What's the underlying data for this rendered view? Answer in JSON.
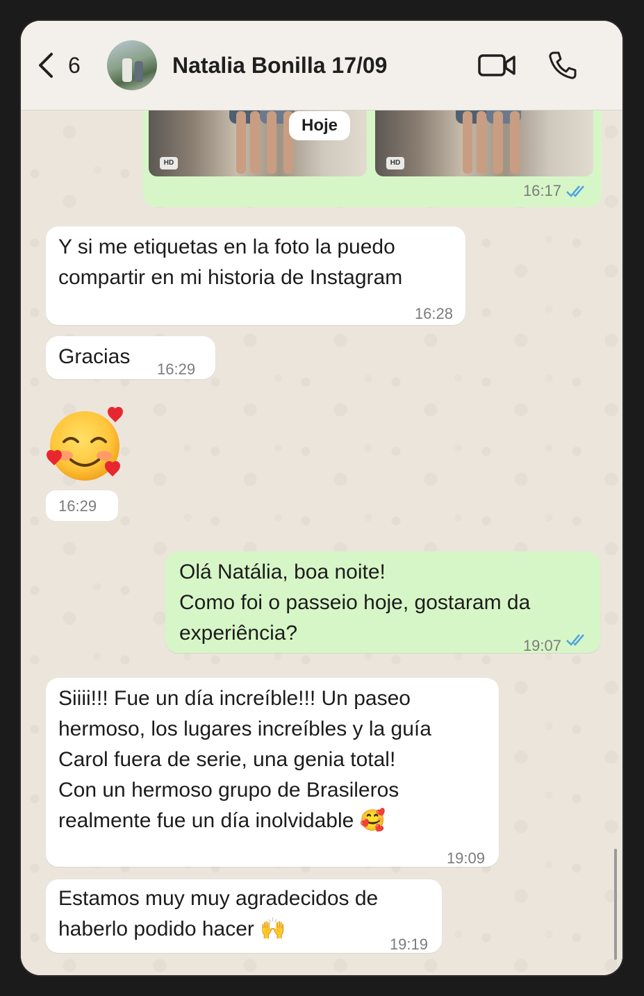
{
  "header": {
    "back_count": "6",
    "contact_name": "Natalia Bonilla 17/09"
  },
  "chat": {
    "date_chip": "Hoje",
    "photo_message": {
      "hd_label": "HD",
      "time": "16:17",
      "read": true
    },
    "messages": [
      {
        "direction": "in",
        "text": "Y si me etiquetas en la foto la puedo\ncompartir en mi historia de Instagram",
        "time": "16:28"
      },
      {
        "direction": "in",
        "text": "Gracias",
        "time": "16:29"
      },
      {
        "direction": "in",
        "text": "🥰",
        "time": "16:29",
        "type": "emoji"
      },
      {
        "direction": "out",
        "text": "Olá Natália, boa noite!\nComo foi o passeio hoje, gostaram da\nexperiência?",
        "time": "19:07",
        "read": true
      },
      {
        "direction": "in",
        "text": "Siiii!!! Fue un día increíble!!! Un paseo\nhermoso, los lugares increíbles y la guía\nCarol fuera de serie, una genia total!\nCon un hermoso grupo de Brasileros\nrealmente fue un día inolvidable 🥰",
        "time": "19:09"
      },
      {
        "direction": "in",
        "text": "Estamos muy muy agradecidos de\nhaberlo podido hacer 🙌",
        "time": "19:19"
      }
    ]
  },
  "colors": {
    "incoming_bubble": "#ffffff",
    "outgoing_bubble": "#d7f6c7",
    "read_ticks": "#4fa3e0"
  }
}
